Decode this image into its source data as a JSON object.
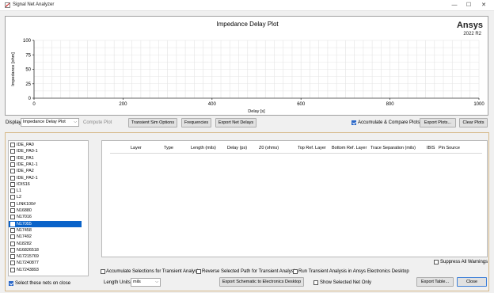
{
  "window": {
    "title": "Signal Net Analyzer"
  },
  "plot": {
    "title": "Impedance Delay Plot",
    "brand": "Ansys",
    "version": "2022 R2",
    "xlabel": "Delay [s]",
    "ylabel": "Impedance [ohm]",
    "x_ticks": [
      "0",
      "200",
      "400",
      "600",
      "800",
      "1000"
    ],
    "y_ticks": [
      "100",
      "75",
      "50",
      "25",
      "0"
    ]
  },
  "chart_data": {
    "type": "line",
    "title": "Impedance Delay Plot",
    "xlabel": "Delay [s]",
    "ylabel": "Impedance [ohm]",
    "xlim": [
      0,
      1000
    ],
    "ylim": [
      0,
      100
    ],
    "grid": true,
    "series": []
  },
  "toolbar": {
    "display_label": "Display",
    "display_value": "Impedance Delay Plot",
    "compute_plot": "Compute Plot",
    "transient_sim_options": "Transient Sim Options",
    "frequencies": "Frequencies",
    "export_net_delays": "Export Net Delays",
    "accumulate_compare": "Accumulate & Compare Plots",
    "accumulate_compare_checked": true,
    "export_plots": "Export Plots...",
    "clear_plots": "Clear Plots"
  },
  "nets": {
    "items": [
      {
        "label": "IDE_PA0",
        "checked": false,
        "selected": false
      },
      {
        "label": "IDE_PA0-1",
        "checked": false,
        "selected": false
      },
      {
        "label": "IDE_PA1",
        "checked": false,
        "selected": false
      },
      {
        "label": "IDE_PA1-1",
        "checked": false,
        "selected": false
      },
      {
        "label": "IDE_PA2",
        "checked": false,
        "selected": false
      },
      {
        "label": "IDE_PA2-1",
        "checked": false,
        "selected": false
      },
      {
        "label": "IOIS16",
        "checked": false,
        "selected": false
      },
      {
        "label": "L1",
        "checked": false,
        "selected": false
      },
      {
        "label": "L2",
        "checked": false,
        "selected": false
      },
      {
        "label": "LINK100#",
        "checked": false,
        "selected": false
      },
      {
        "label": "N16880",
        "checked": false,
        "selected": false
      },
      {
        "label": "N17016",
        "checked": false,
        "selected": false
      },
      {
        "label": "N17055",
        "checked": false,
        "selected": true
      },
      {
        "label": "N17458",
        "checked": false,
        "selected": false
      },
      {
        "label": "N17492",
        "checked": false,
        "selected": false
      },
      {
        "label": "N18282",
        "checked": false,
        "selected": false
      },
      {
        "label": "N16826518",
        "checked": false,
        "selected": false
      },
      {
        "label": "N17215769",
        "checked": false,
        "selected": false
      },
      {
        "label": "N17240877",
        "checked": false,
        "selected": false
      },
      {
        "label": "N17243893",
        "checked": false,
        "selected": false
      }
    ],
    "select_on_close_label": "Select these nets on close",
    "select_on_close_checked": true
  },
  "table": {
    "columns": [
      "Layer",
      "Type",
      "Length (mils)",
      "Delay (ps)",
      "Z0 (ohms)",
      "Top Ref. Layer",
      "Bottom Ref. Layer",
      "Trace Separation (mils)",
      "IBIS",
      "Pin Source"
    ],
    "rows": []
  },
  "options": {
    "suppress_warnings": "Suppress All Warnings",
    "accumulate_selections": "Accumulate Selections for Transient Analysis",
    "reverse_path": "Reverse Selected Path for Transient Analysis",
    "run_transient": "Run Transient Analysis in Ansys Electronics Desktop",
    "length_units_label": "Length Units",
    "length_units_value": "mils",
    "export_schematic": "Export Schematic to Electronics Desktop",
    "show_selected_net_only": "Show Selected Net Only",
    "export_table": "Export Table...",
    "close": "Close"
  }
}
